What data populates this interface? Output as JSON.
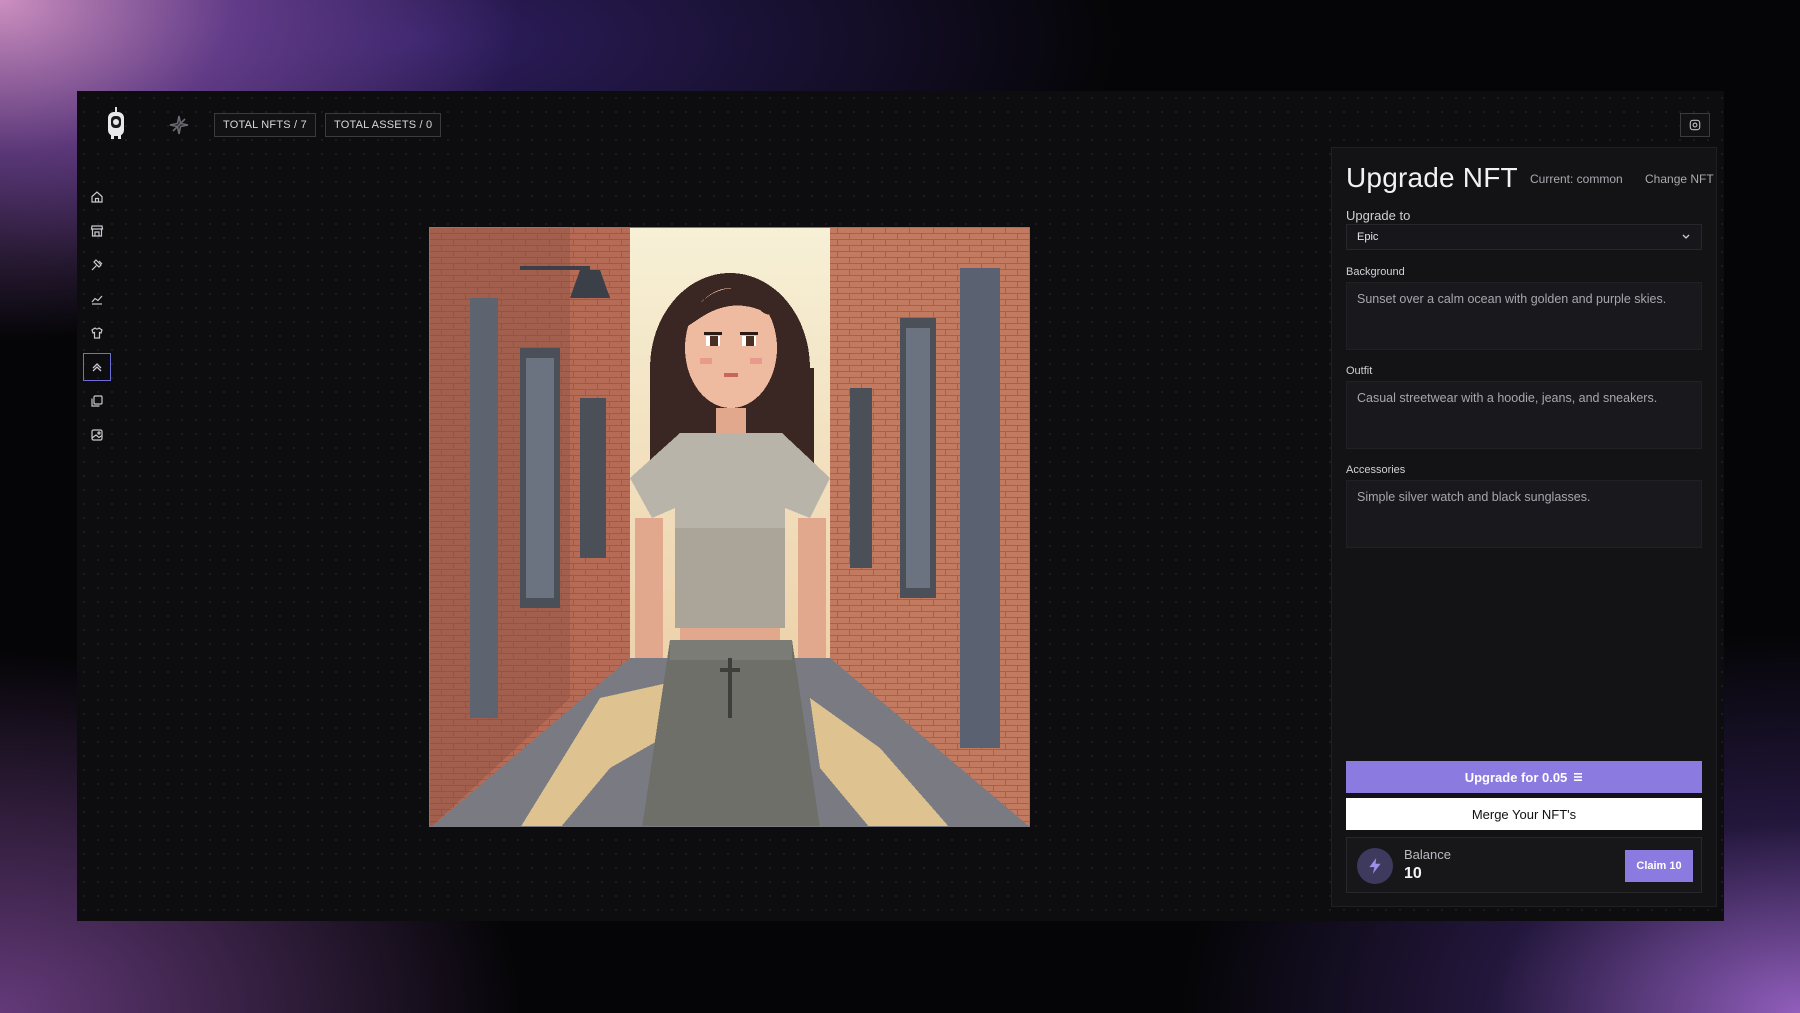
{
  "topbar": {
    "total_nfts": "TOTAL NFTS / 7",
    "total_assets": "TOTAL ASSETS / 0"
  },
  "sidebar": {
    "items": [
      {
        "icon": "home-icon"
      },
      {
        "icon": "store-icon"
      },
      {
        "icon": "hammer-icon"
      },
      {
        "icon": "chart-icon"
      },
      {
        "icon": "shirt-icon"
      },
      {
        "icon": "upgrade-icon",
        "active": true
      },
      {
        "icon": "layers-icon"
      },
      {
        "icon": "image-gallery-icon"
      }
    ]
  },
  "panel": {
    "title": "Upgrade NFT",
    "current": "Current: common",
    "change_link": "Change NFT",
    "upgrade_to_label": "Upgrade to",
    "upgrade_to_value": "Epic",
    "background_label": "Background",
    "background_value": "Sunset over a calm ocean with golden and purple skies.",
    "outfit_label": "Outfit",
    "outfit_value": "Casual streetwear with a hoodie, jeans, and sneakers.",
    "accessories_label": "Accessories",
    "accessories_value": "Simple silver watch and black sunglasses.",
    "upgrade_button": "Upgrade for 0.05",
    "merge_button": "Merge Your NFT's",
    "balance_label": "Balance",
    "balance_value": "10",
    "claim_button": "Claim 10"
  },
  "colors": {
    "accent": "#8b7be0",
    "active_border": "#6d6fd6",
    "panel_bg": "#131316"
  }
}
